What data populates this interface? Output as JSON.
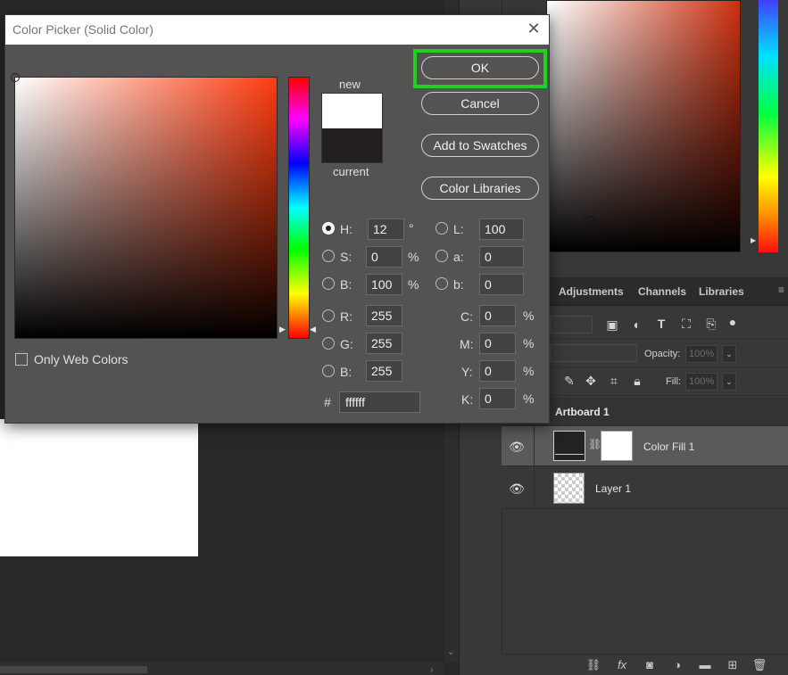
{
  "dialog": {
    "title": "Color Picker (Solid Color)",
    "close_icon": "close-icon",
    "new_label": "new",
    "current_label": "current",
    "new_color": "#ffffff",
    "current_color": "#231f20",
    "buttons": {
      "ok": "OK",
      "cancel": "Cancel",
      "add_to_swatches": "Add to Swatches",
      "color_libraries": "Color Libraries"
    },
    "highlight_color": "#1ed21e",
    "hsb": {
      "h_label": "H:",
      "h_value": "12",
      "h_unit": "°",
      "s_label": "S:",
      "s_value": "0",
      "s_unit": "%",
      "b_label": "B:",
      "b_value": "100",
      "b_unit": "%"
    },
    "rgb": {
      "r_label": "R:",
      "r_value": "255",
      "g_label": "G:",
      "g_value": "255",
      "b_label": "B:",
      "b_value": "255"
    },
    "lab": {
      "l_label": "L:",
      "l_value": "100",
      "a_label": "a:",
      "a_value": "0",
      "b_label": "b:",
      "b_value": "0"
    },
    "cmyk": {
      "c_label": "C:",
      "c_value": "0",
      "m_label": "M:",
      "m_value": "0",
      "y_label": "Y:",
      "y_value": "0",
      "k_label": "K:",
      "k_value": "0",
      "unit": "%"
    },
    "hex_label": "#",
    "hex_value": "ffffff",
    "only_web_colors": "Only Web Colors"
  },
  "panels": {
    "tabs": [
      "Adjustments",
      "Channels",
      "Libraries"
    ],
    "opacity_label": "Opacity:",
    "opacity_value": "100%",
    "fill_label": "Fill:",
    "fill_value": "100%",
    "layers": {
      "artboard": "Artboard 1",
      "color_fill": "Color Fill 1",
      "layer1": "Layer 1"
    }
  }
}
